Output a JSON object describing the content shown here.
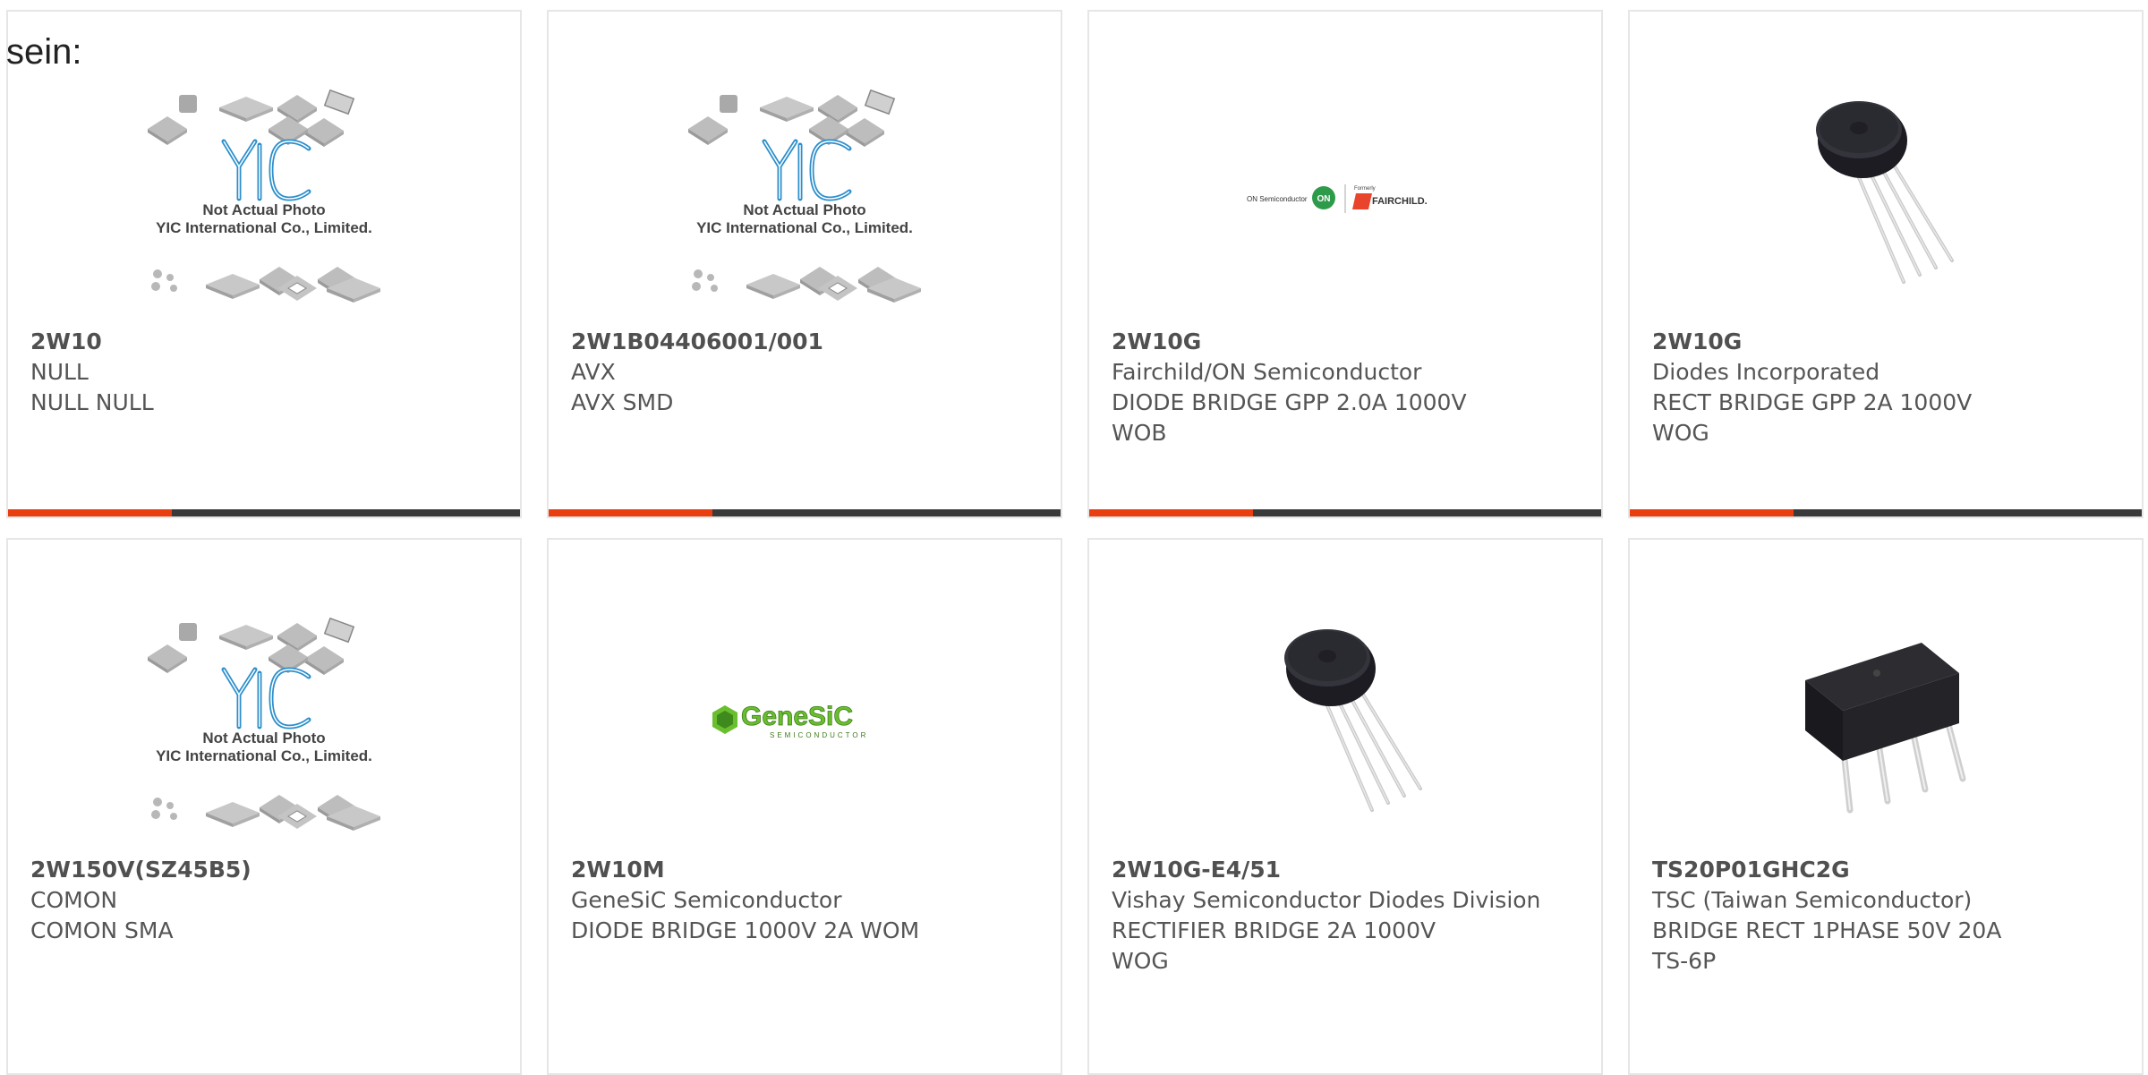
{
  "prefix_text": "sein:",
  "placeholder": {
    "line1": "Not Actual Photo",
    "line2": "YIC International Co., Limited.",
    "logo": "YIC"
  },
  "onsemi_logo": {
    "left": "ON Semiconductor",
    "mark": "ON",
    "formerly": "Formerly",
    "right": "FAIRCHILD."
  },
  "genesic_logo": {
    "name": "GeneSiC",
    "sub": "SEMICONDUCTOR"
  },
  "colors": {
    "accent": "#e83e10",
    "bar": "#3a3a3a",
    "border": "#e6e6e6",
    "text": "#555555"
  },
  "products": [
    {
      "part": "2W10",
      "manufacturer": "NULL",
      "desc1": "NULL NULL",
      "desc2": "",
      "image": "placeholder"
    },
    {
      "part": "2W1B04406001/001",
      "manufacturer": "AVX",
      "desc1": "AVX SMD",
      "desc2": "",
      "image": "placeholder"
    },
    {
      "part": "2W10G",
      "manufacturer": "Fairchild/ON Semiconductor",
      "desc1": "DIODE BRIDGE GPP 2.0A 1000V",
      "desc2": "WOB",
      "image": "onsemi-fairchild-logo"
    },
    {
      "part": "2W10G",
      "manufacturer": "Diodes Incorporated",
      "desc1": "RECT BRIDGE GPP 2A 1000V",
      "desc2": "WOG",
      "image": "round-bridge-rectifier"
    },
    {
      "part": "2W150V(SZ45B5)",
      "manufacturer": "COMON",
      "desc1": "COMON SMA",
      "desc2": "",
      "image": "placeholder"
    },
    {
      "part": "2W10M",
      "manufacturer": "GeneSiC Semiconductor",
      "desc1": "DIODE BRIDGE 1000V 2A WOM",
      "desc2": "",
      "image": "genesic-logo"
    },
    {
      "part": "2W10G-E4/51",
      "manufacturer": "Vishay Semiconductor Diodes Division",
      "desc1": "RECTIFIER BRIDGE 2A 1000V",
      "desc2": "WOG",
      "image": "round-bridge-rectifier"
    },
    {
      "part": "TS20P01GHC2G",
      "manufacturer": "TSC (Taiwan Semiconductor)",
      "desc1": "BRIDGE RECT 1PHASE 50V 20A",
      "desc2": "TS-6P",
      "image": "flat-bridge-rectifier"
    }
  ]
}
